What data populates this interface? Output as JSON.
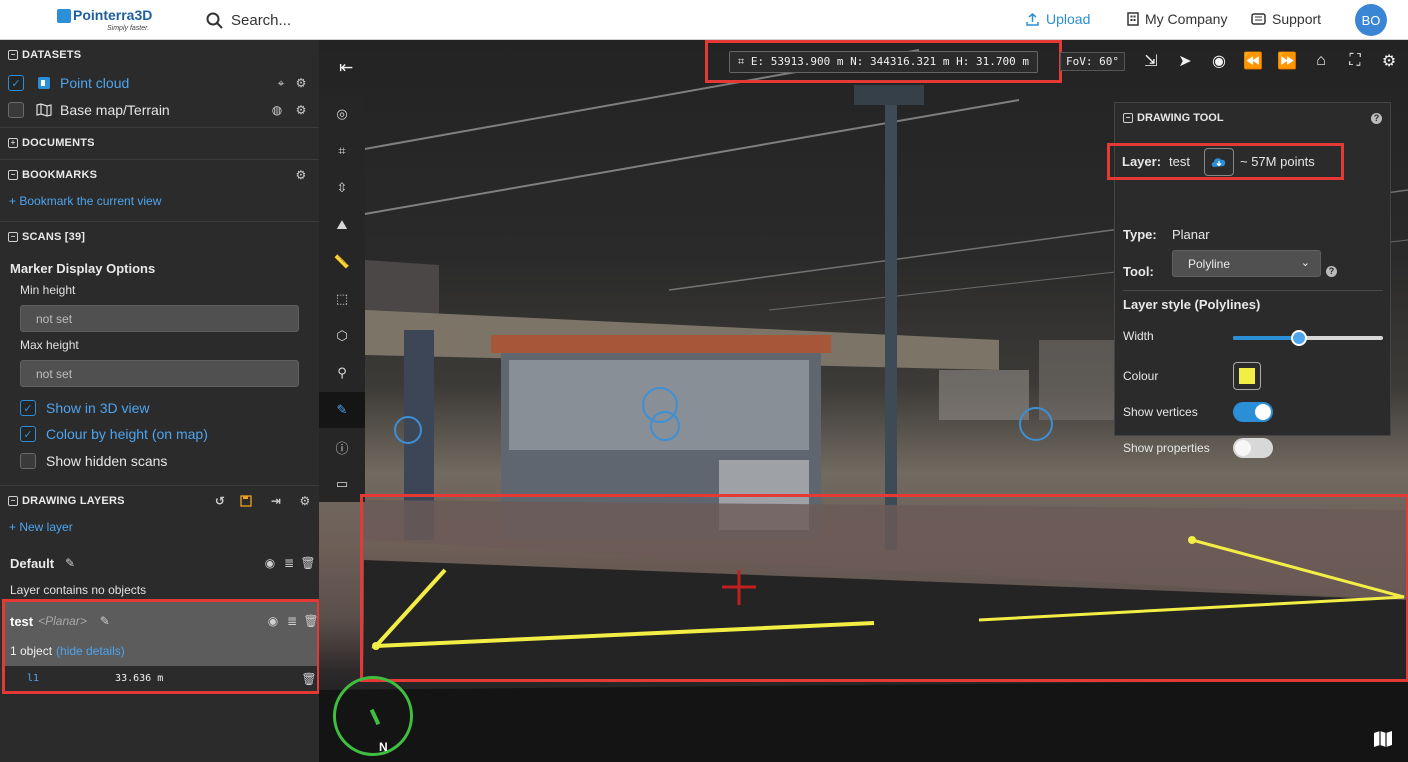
{
  "header": {
    "logo": "Pointerra3D",
    "tagline": "Simply faster.",
    "search_placeholder": "Search...",
    "upload": "Upload",
    "company": "My Company",
    "support": "Support",
    "avatar": "BO"
  },
  "sidebar": {
    "datasets": {
      "title": "DATASETS",
      "items": [
        {
          "label": "Point cloud",
          "checked": true
        },
        {
          "label": "Base map/Terrain",
          "checked": false
        }
      ]
    },
    "documents": {
      "title": "DOCUMENTS"
    },
    "bookmarks": {
      "title": "BOOKMARKS",
      "add": "+ Bookmark the current view"
    },
    "scans": {
      "title": "SCANS [39]",
      "marker_title": "Marker Display Options",
      "min_height_label": "Min height",
      "min_height_value": "not set",
      "max_height_label": "Max height",
      "max_height_value": "not set",
      "show_3d": "Show in 3D view",
      "colour_by_height": "Colour by height (on map)",
      "show_hidden": "Show hidden scans"
    },
    "drawing_layers": {
      "title": "DRAWING LAYERS",
      "new_layer": "+ New layer",
      "default_name": "Default",
      "default_info": "Layer contains no objects",
      "test_name": "test",
      "test_type": "<Planar>",
      "test_count": "1 object",
      "hide_details": "(hide details)",
      "object_id": "l1",
      "object_length": "33.636 m"
    }
  },
  "viewport": {
    "coords": "E: 53913.900 m N: 344316.321 m H: 31.700 m",
    "fov": "FoV: 60°",
    "compass_label": "N"
  },
  "drawing_tool": {
    "title": "DRAWING TOOL",
    "layer_label": "Layer:",
    "layer_value": "test",
    "points": "~ 57M points",
    "type_label": "Type:",
    "type_value": "Planar",
    "tool_label": "Tool:",
    "tool_value": "Polyline",
    "style_title": "Layer style (Polylines)",
    "width_label": "Width",
    "width_level": 0.44,
    "colour_label": "Colour",
    "colour_value": "#f3ee45",
    "show_vertices_label": "Show vertices",
    "show_vertices": true,
    "show_properties_label": "Show properties",
    "show_properties": false
  }
}
